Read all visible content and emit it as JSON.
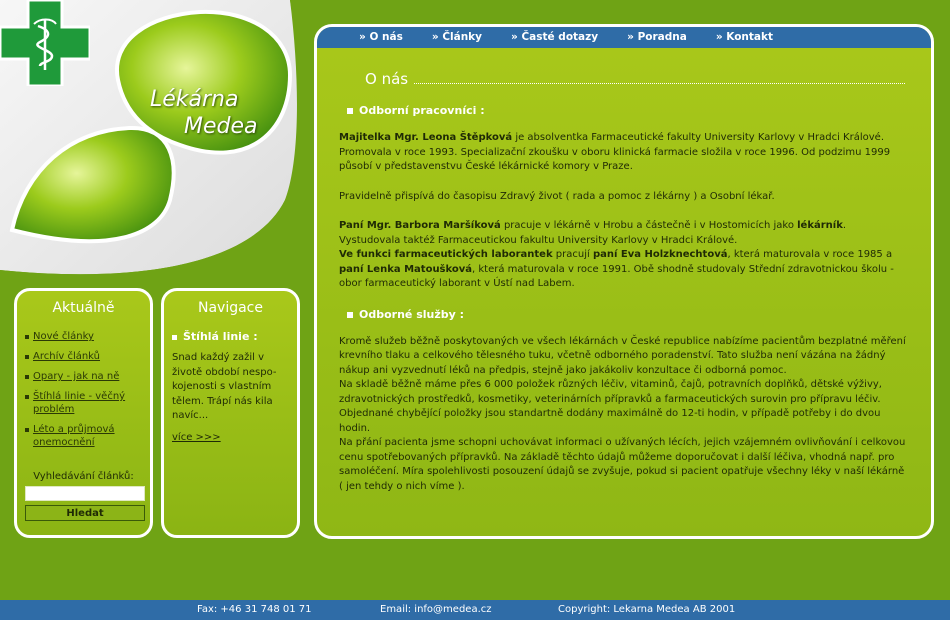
{
  "brand": {
    "line1": "Lékárna",
    "line2": "Medea"
  },
  "colors": {
    "background": "#6fa315",
    "nav_bar": "#2f6ca7",
    "cross": "#1f9a3a"
  },
  "topnav": [
    "O nás",
    "Články",
    "Časté dotazy",
    "Poradna",
    "Kontakt"
  ],
  "sidebar_news": {
    "title": "Aktuálně",
    "items": [
      "Nové články",
      "Archív článků",
      "Opary - jak na ně",
      "Štíhlá linie - věčný problém",
      "Léto a průjmová onemocnění"
    ],
    "search_label": "Vyhledávání článků:",
    "search_value": "",
    "search_button": "Hledat"
  },
  "sidebar_nav": {
    "title": "Navigace",
    "heading": "Štíhlá linie :",
    "text": "Snad každý zažil v životě období nespo-kojenosti s vlastním tělem. Trápí nás kila navíc...",
    "more": "více >>>"
  },
  "main": {
    "heading": "O nás",
    "section1_title": "Odborní pracovníci :",
    "p1": {
      "bold": "Majitelka Mgr. Leona Štěpková",
      "text": " je absolventka Farmaceutické fakulty University Karlovy v Hradci Králové. Promovala v roce 1993. Specializační zkoušku v oboru klinická farmacie složila v roce 1996. Od podzimu 1999 působí v představenstvu České lékárnické komory v Praze."
    },
    "p2": "Pravidelně přispívá do časopisu Zdravý život ( rada a pomoc z lékárny ) a Osobní lékař.",
    "p3": {
      "bold1": "Paní Mgr. Barbora Maršíková",
      "text1": " pracuje v lékárně v Hrobu a částečně i v Hostomicích jako ",
      "bold2": "lékárník",
      "text2": ". Vystudovala taktéž Farmaceutickou fakultu University Karlovy v Hradci Králové."
    },
    "p4": {
      "bold1": "Ve funkci farmaceutických laborantek",
      "text1": " pracují ",
      "bold2": "paní Eva Holzknechtová",
      "text2": ", která maturovala v roce 1985 a ",
      "bold3": "paní Lenka Matoušková",
      "text3": ", která maturovala v roce 1991. Obě shodně studovaly Střední zdravotnickou školu - obor farmaceutický laborant v Ústí nad Labem."
    },
    "section2_title": "Odborné služby :",
    "s1": "Kromě služeb běžně poskytovaných ve všech lékárnách v České republice nabízíme pacientům bezplatné měření krevního tlaku a celkového tělesného tuku, včetně odborného poradenství. Tato služba není vázána na žádný nákup ani vyzvednutí léků na předpis, stejně jako jakákoliv konzultace či odborná pomoc.",
    "s2": "Na skladě běžně máme přes 6 000 položek různých léčiv, vitaminů, čajů, potravních doplňků, dětské výživy, zdravotnických prostředků, kosmetiky, veterinárních přípravků a farmaceutických surovin pro přípravu léčiv. Objednané chybějící položky jsou standartně dodány maximálně do 12-ti hodin, v případě potřeby i do dvou hodin.",
    "s3": "Na přání pacienta jsme schopni uchovávat informaci o užívaných lécích, jejich vzájemném ovlivňování i celkovou cenu spotřebovaných přípravků. Na základě těchto údajů můžeme doporučovat i další léčiva, vhodná např. pro samoléčení. Míra spolehlivosti posouzení údajů se zvyšuje, pokud si pacient opatřuje všechny léky v naší lékárně ( jen tehdy o nich víme )."
  },
  "footer": {
    "fax": "Fax: +46 31 748 01 71",
    "email": "Email: info@medea.cz",
    "copyright": "Copyright: Lekarna Medea AB 2001"
  }
}
